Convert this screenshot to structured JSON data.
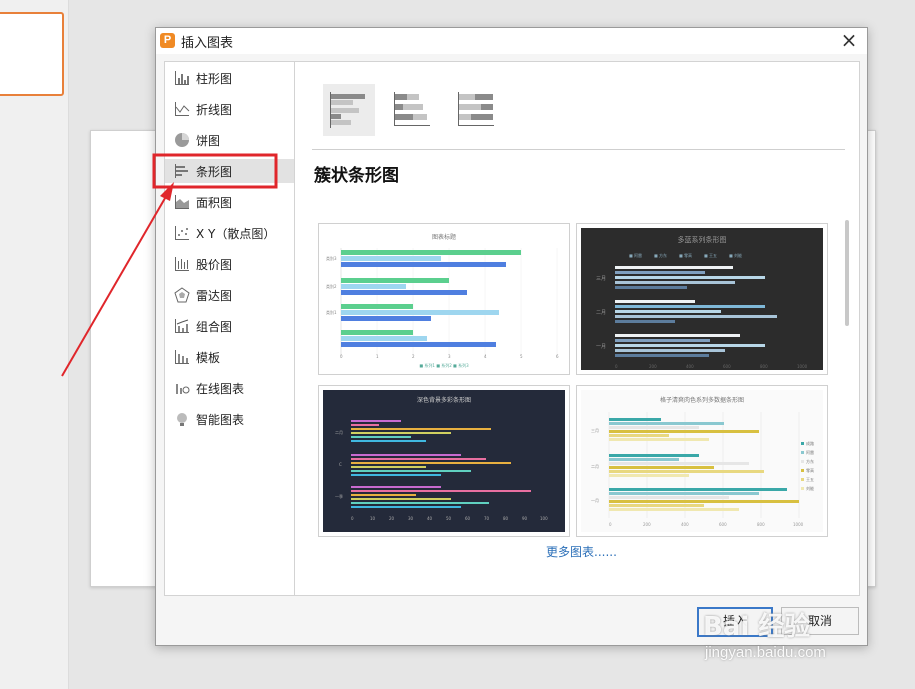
{
  "dialog": {
    "title": "插入图表",
    "close": "×",
    "app_icon": "P"
  },
  "sidebar": {
    "items": [
      {
        "label": "柱形图",
        "icon": "column-chart-icon"
      },
      {
        "label": "折线图",
        "icon": "line-chart-icon"
      },
      {
        "label": "饼图",
        "icon": "pie-chart-icon"
      },
      {
        "label": "条形图",
        "icon": "bar-chart-icon",
        "selected": true
      },
      {
        "label": "面积图",
        "icon": "area-chart-icon"
      },
      {
        "label": "X Y（散点图）",
        "icon": "scatter-chart-icon"
      },
      {
        "label": "股价图",
        "icon": "stock-chart-icon"
      },
      {
        "label": "雷达图",
        "icon": "radar-chart-icon"
      },
      {
        "label": "组合图",
        "icon": "combo-chart-icon"
      },
      {
        "label": "模板",
        "icon": "template-icon"
      },
      {
        "label": "在线图表",
        "icon": "online-chart-icon"
      },
      {
        "label": "智能图表",
        "icon": "smart-chart-icon"
      }
    ]
  },
  "content": {
    "section_title": "簇状条形图",
    "more_link": "更多图表......",
    "templates": [
      {
        "title": "图表标题",
        "categories": [
          "类别3",
          "类别2",
          "类别1"
        ],
        "ticks": [
          "0",
          "1",
          "2",
          "3",
          "4",
          "5",
          "6"
        ],
        "legend": "■ 系列1 ■ 系列2 ■ 系列3"
      },
      {
        "title": "多蓝系列条形图",
        "categories": [
          "三月",
          "二月",
          "一月"
        ],
        "legend": [
          "■ 阿雷",
          "■ 方东",
          "■ 零高",
          "■ 王五",
          "■ 刘能"
        ],
        "ticks": [
          "0",
          "200",
          "400",
          "600",
          "800",
          "1000"
        ]
      },
      {
        "title": "深色背景多彩条形图",
        "categories": [
          "二月",
          "C",
          "一季"
        ],
        "ticks": [
          "0",
          "10",
          "20",
          "30",
          "40",
          "50",
          "60",
          "70",
          "80",
          "90",
          "100"
        ]
      },
      {
        "title": "格子清爽肉色系列多数据条形图",
        "categories": [
          "三月",
          "二月",
          "一月"
        ],
        "legend": [
          "成路",
          "阿雷",
          "方东",
          "零高",
          "王五",
          "刘能"
        ],
        "ticks": [
          "0",
          "200",
          "400",
          "600",
          "800",
          "1000"
        ]
      }
    ]
  },
  "buttons": {
    "insert": "插入",
    "cancel": "取消"
  },
  "watermark": {
    "brand": "Bai 经验",
    "url": "jingyan.baidu.com"
  },
  "colors": {
    "highlight_red": "#e0262b",
    "accent_orange": "#f08a24",
    "link_blue": "#2b6fb8"
  }
}
